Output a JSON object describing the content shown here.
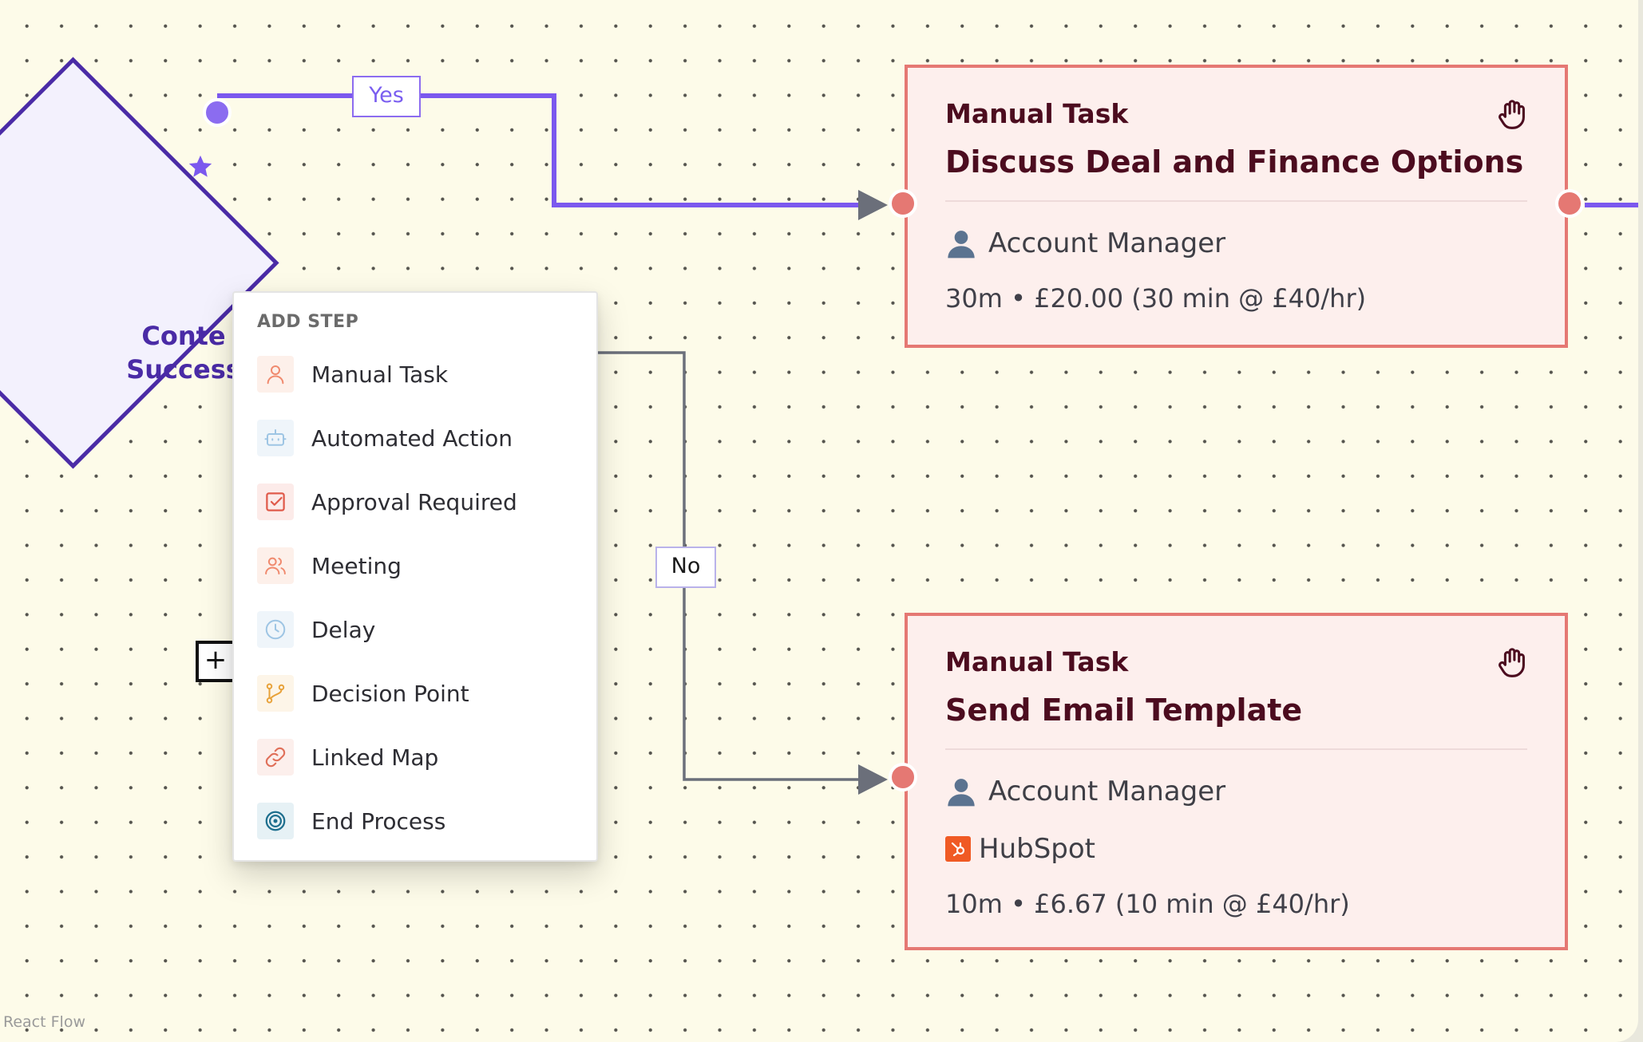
{
  "edges": {
    "yes_label": "Yes",
    "no_label": "No"
  },
  "decision": {
    "label_line1": "Conte",
    "label_line2": "Success"
  },
  "add_step_menu": {
    "title": "ADD STEP",
    "items": [
      {
        "label": "Manual Task",
        "icon": "person-icon",
        "color": "#f08a6e",
        "bg": "#fdf0ea"
      },
      {
        "label": "Automated Action",
        "icon": "robot-icon",
        "color": "#9ec5e4",
        "bg": "#eff5fa"
      },
      {
        "label": "Approval Required",
        "icon": "checkbox-icon",
        "color": "#e05a4a",
        "bg": "#fcebe9"
      },
      {
        "label": "Meeting",
        "icon": "people-icon",
        "color": "#f08a6e",
        "bg": "#fdf0ea"
      },
      {
        "label": "Delay",
        "icon": "clock-icon",
        "color": "#9ec5e4",
        "bg": "#eff5fa"
      },
      {
        "label": "Decision Point",
        "icon": "branch-icon",
        "color": "#e8a23a",
        "bg": "#fdf5e8"
      },
      {
        "label": "Linked Map",
        "icon": "link-icon",
        "color": "#e0705a",
        "bg": "#fcefec"
      },
      {
        "label": "End Process",
        "icon": "target-icon",
        "color": "#1e6f8e",
        "bg": "#e6f1f5"
      }
    ]
  },
  "cards": [
    {
      "type": "Manual Task",
      "title": "Discuss Deal and Finance Options",
      "role": "Account Manager",
      "cost": "30m • £20.00 (30 min @ £40/hr)"
    },
    {
      "type": "Manual Task",
      "title": "Send Email Template",
      "role": "Account Manager",
      "tool": "HubSpot",
      "cost": "10m • £6.67 (10 min @ £40/hr)"
    }
  ],
  "colors": {
    "canvas": "#fdfbe9",
    "decision_border": "#4a2ba6",
    "yes_edge": "#7b58ee",
    "no_edge": "#6b6f7a",
    "card_border": "#e57873",
    "card_title": "#4c0c1f"
  },
  "watermark": "React Flow"
}
